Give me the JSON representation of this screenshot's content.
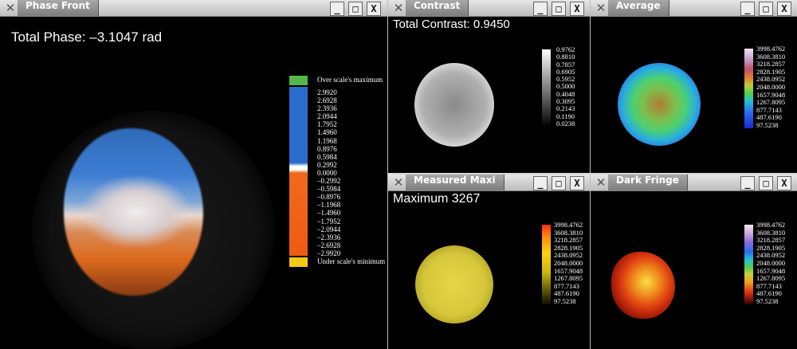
{
  "colors": {
    "titlebar": "#c9c9c9",
    "tab": "#8f8f8f",
    "window_bg": "#000000"
  },
  "titlebar_buttons": {
    "app_icon": "x-app-icon",
    "minimize": "_",
    "maximize": "□",
    "close": "X"
  },
  "phase_front": {
    "title": "Phase Front",
    "overlay_text": "Total Phase: –3.1047 rad",
    "scale_over_label": "Over scale's maximum",
    "scale_under_label": "Under scale's minimum",
    "scale_ticks": [
      "2.9920",
      "2.6928",
      "2.3936",
      "2.0944",
      "1.7952",
      "1.4960",
      "1.1968",
      "0.8976",
      "0.5984",
      "0.2992",
      "0.0000",
      "–0.2992",
      "–0.5984",
      "–0.8976",
      "–1.1968",
      "–1.4960",
      "–1.7952",
      "–2.0944",
      "–2.3936",
      "–2.6928",
      "–2.9920"
    ]
  },
  "contrast": {
    "title": "Contrast",
    "overlay_text": "Total Contrast: 0.9450",
    "scale_ticks": [
      "0.9762",
      "0.8810",
      "0.7857",
      "0.6905",
      "0.5952",
      "0.5000",
      "0.4048",
      "0.3095",
      "0.2143",
      "0.1190",
      "0.0238"
    ]
  },
  "average": {
    "title": "Average",
    "scale_ticks": [
      "3998.4762",
      "3608.3810",
      "3218.2857",
      "2828.1905",
      "2438.0952",
      "2048.0000",
      "1657.9048",
      "1267.8095",
      "877.7143",
      "487.6190",
      "97.5238"
    ]
  },
  "measured_maximum": {
    "title": "Measured Maxi",
    "overlay_text": "Maximum 3267",
    "scale_ticks": [
      "3998.4762",
      "3608.3810",
      "3218.2857",
      "2828.1905",
      "2438.0952",
      "2048.0000",
      "1657.9048",
      "1267.8095",
      "877.7143",
      "487.6190",
      "97.5238"
    ]
  },
  "dark_fringe": {
    "title": "Dark Fringe",
    "scale_ticks": [
      "3998.4762",
      "3608.3810",
      "3218.2857",
      "2828.1905",
      "2438.0952",
      "2048.0000",
      "1657.9048",
      "1267.8095",
      "877.7143",
      "487.6190",
      "97.5238"
    ]
  }
}
